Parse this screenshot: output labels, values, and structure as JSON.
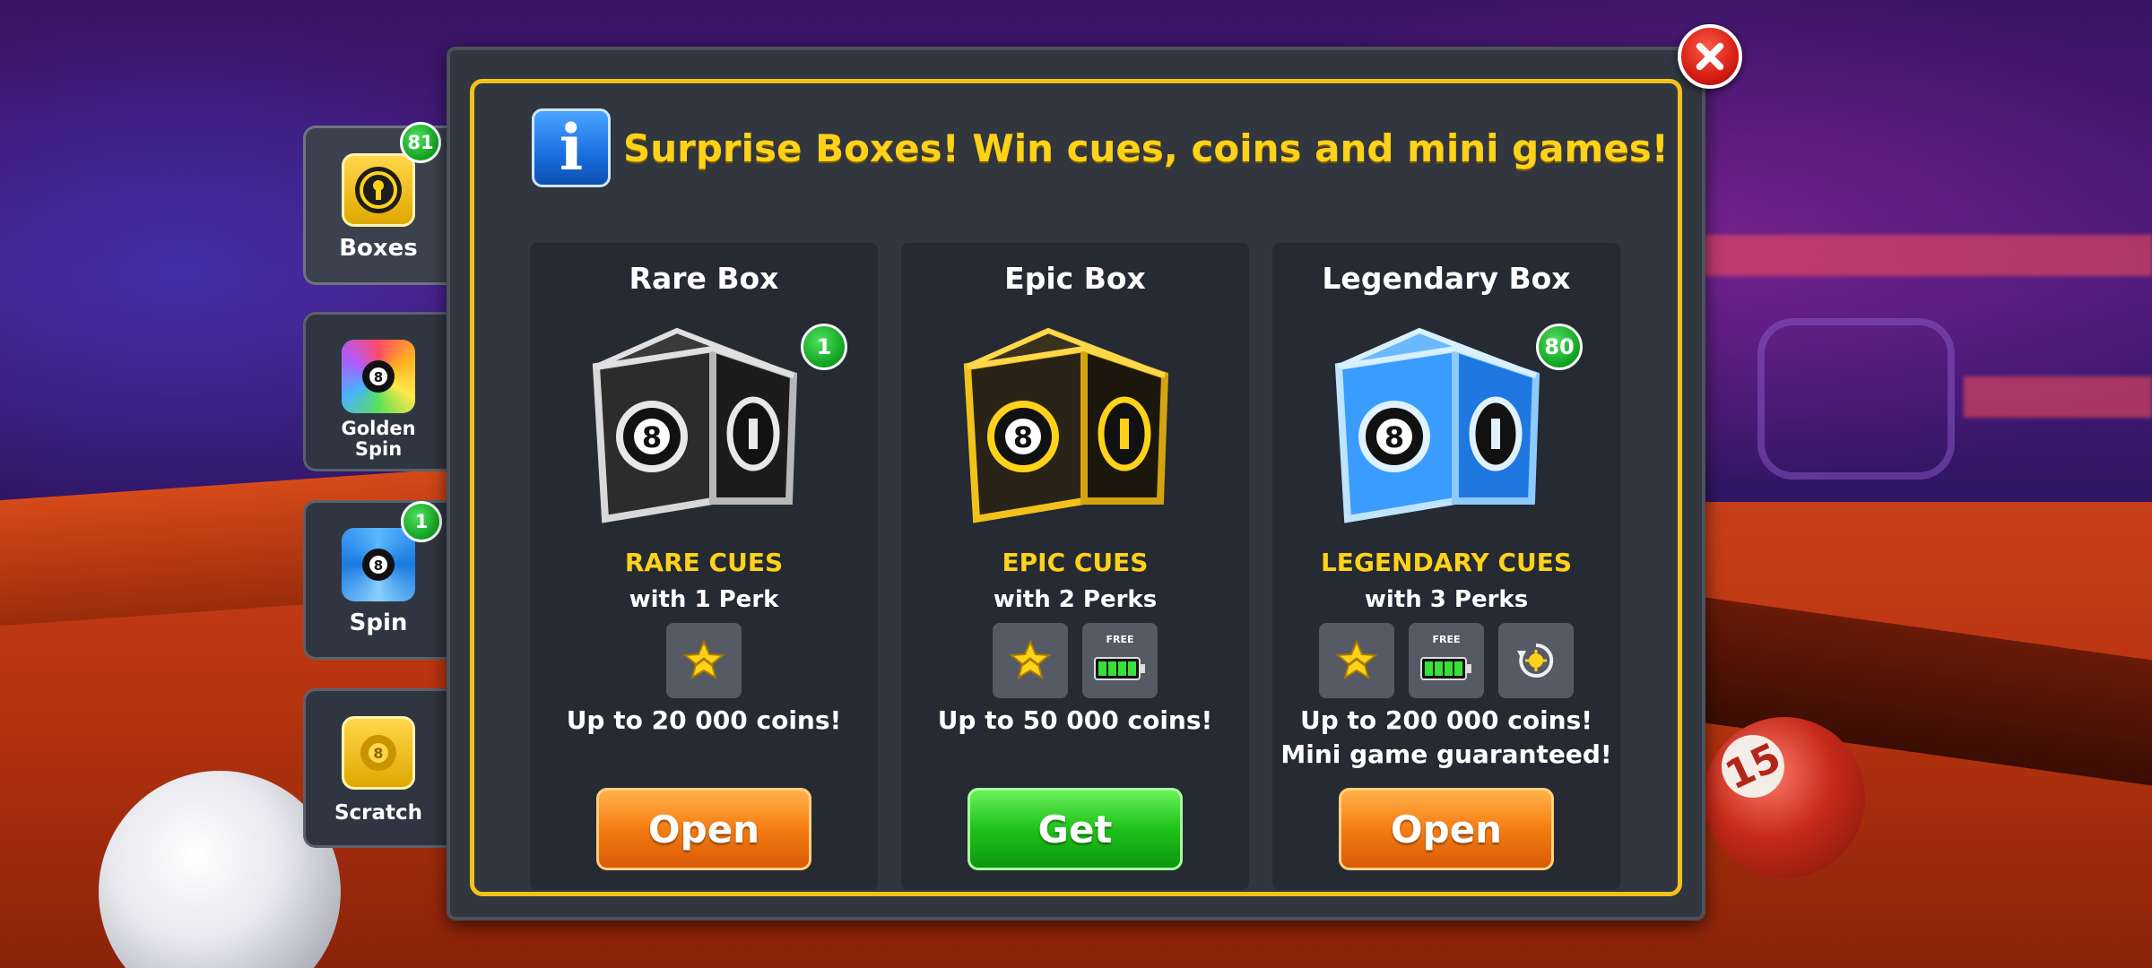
{
  "close": {
    "icon": "close-icon"
  },
  "tabs": [
    {
      "label": "Boxes",
      "badge": "81",
      "active": true
    },
    {
      "label": "Golden\nSpin",
      "badge": ""
    },
    {
      "label": "Spin",
      "badge": "1"
    },
    {
      "label": "Scratch",
      "badge": ""
    }
  ],
  "header": {
    "title": "Surprise Boxes! Win cues, coins and mini games!",
    "info_letter": "i"
  },
  "cards": [
    {
      "title": "Rare Box",
      "badge": "1",
      "cue_type": "RARE CUES",
      "perks": "with 1 Perk",
      "coins": "Up to 20 000  coins!",
      "extra": "",
      "button": "Open",
      "button_color": "orange"
    },
    {
      "title": "Epic Box",
      "badge": "",
      "cue_type": "EPIC CUES",
      "perks": "with 2 Perks",
      "coins": "Up to 50 000 coins!",
      "extra": "",
      "button": "Get",
      "button_color": "green"
    },
    {
      "title": "Legendary Box",
      "badge": "80",
      "cue_type": "LEGENDARY CUES",
      "perks": "with 3 Perks",
      "coins": "Up to 200 000 coins!",
      "extra": "Mini game guaranteed!",
      "button": "Open",
      "button_color": "orange"
    }
  ],
  "perk_free_label": "FREE",
  "background": {
    "ball_number": "15"
  },
  "colors": {
    "accent_yellow": "#ffd21a",
    "frame": "#f2c21a",
    "orange": "#f57d12",
    "green": "#1fc21a"
  }
}
